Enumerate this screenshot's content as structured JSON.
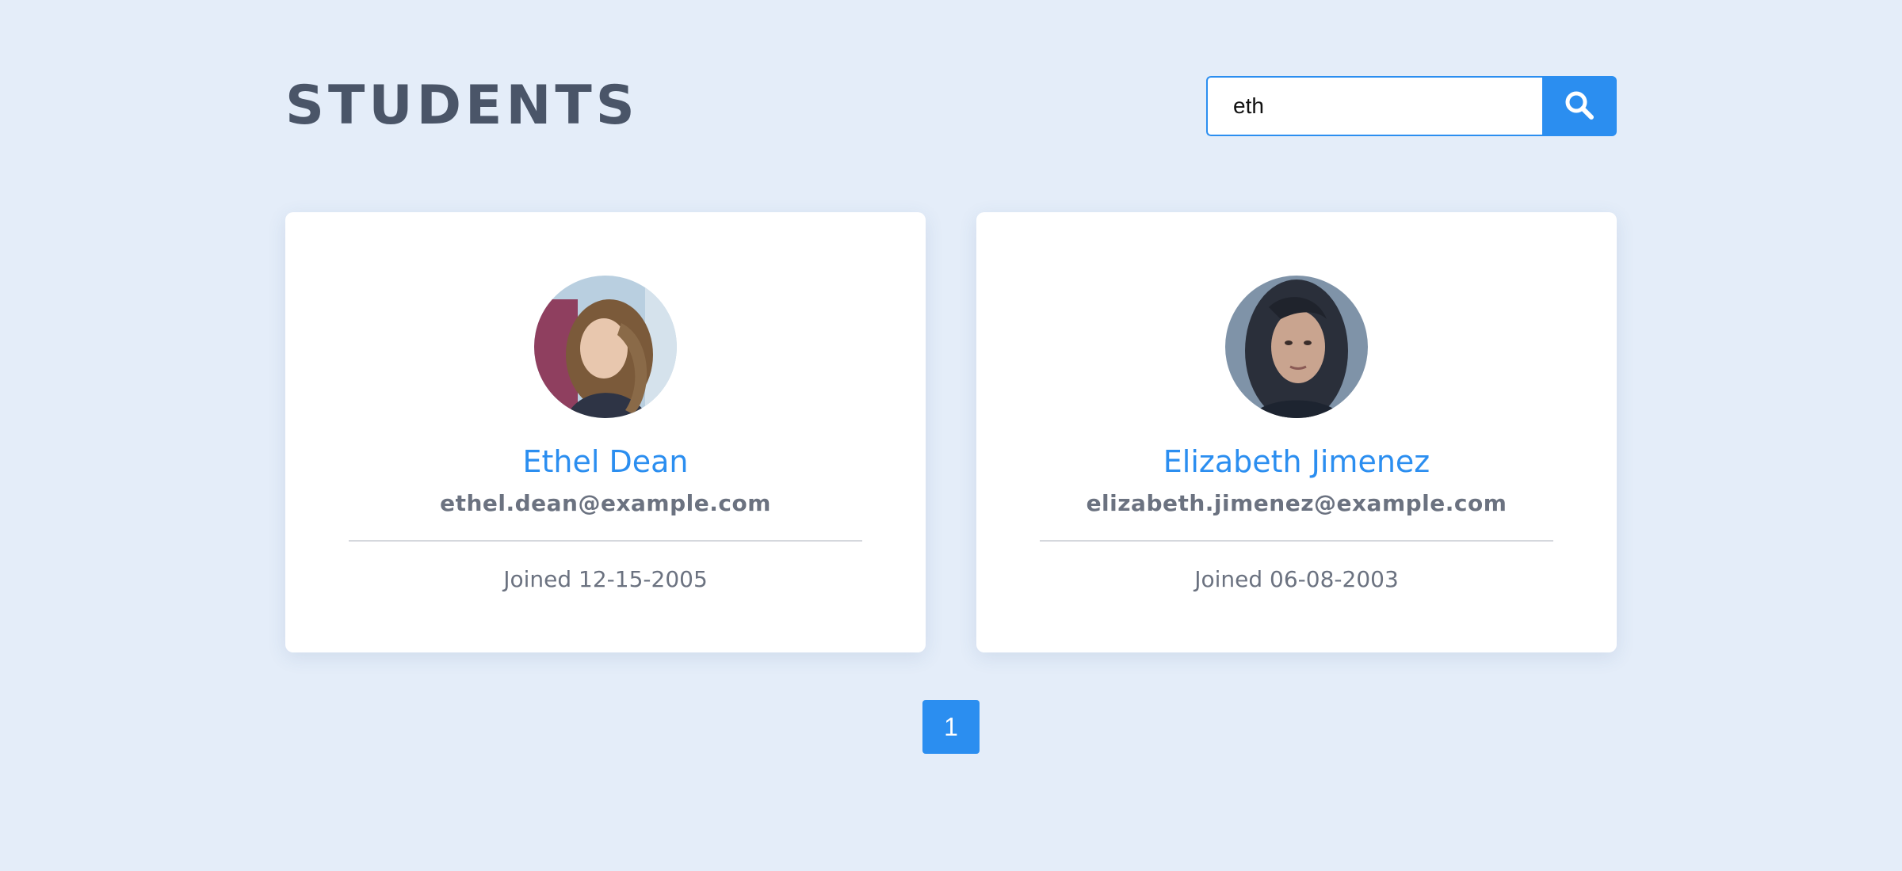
{
  "header": {
    "title": "STUDENTS"
  },
  "search": {
    "value": "eth",
    "button_icon": "search-icon"
  },
  "students": [
    {
      "name": "Ethel Dean",
      "email": "ethel.dean@example.com",
      "joined": "Joined 12-15-2005",
      "avatar_icon": "avatar-photo"
    },
    {
      "name": "Elizabeth Jimenez",
      "email": "elizabeth.jimenez@example.com",
      "joined": "Joined 06-08-2003",
      "avatar_icon": "avatar-photo"
    }
  ],
  "pagination": {
    "pages": [
      "1"
    ],
    "current": "1"
  },
  "colors": {
    "background": "#e4edf9",
    "accent": "#2b8ef0",
    "title": "#4a5568",
    "muted_text": "#6b7280",
    "card": "#ffffff"
  }
}
